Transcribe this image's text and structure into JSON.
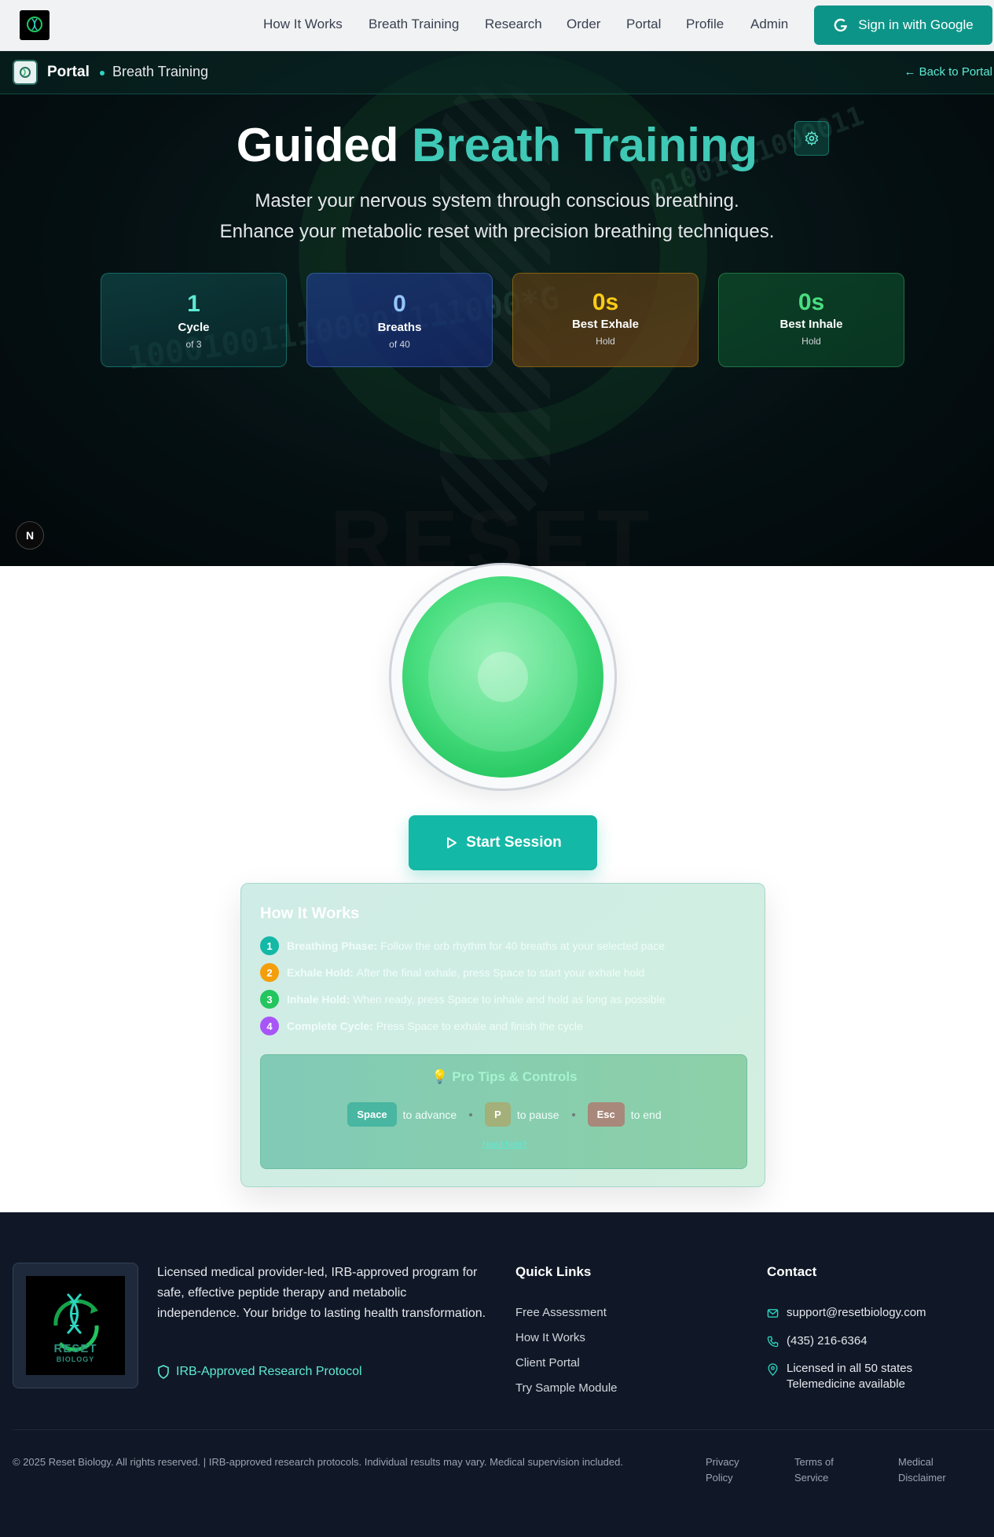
{
  "nav": {
    "links": [
      "How It Works",
      "Breath Training",
      "Research",
      "Order",
      "Portal",
      "Profile",
      "Admin"
    ],
    "sign_in": "Sign in with Google"
  },
  "breadcrumb": {
    "portal": "Portal",
    "page": "Breath Training",
    "back": "← Back to Portal"
  },
  "hero": {
    "title_1": "Guided",
    "title_2": "Breath Training",
    "subtitle_1": "Master your nervous system through conscious breathing.",
    "subtitle_2": "Enhance your metabolic reset with precision breathing techniques.",
    "bg_binary_1": "01001011000011",
    "bg_binary_2": "100010011100001111000*G",
    "bg_reset": "RESET",
    "next_badge": "N"
  },
  "stats": [
    {
      "value": "1",
      "label": "Cycle",
      "sub": "of 3",
      "color": "#5eead4"
    },
    {
      "value": "0",
      "label": "Breaths",
      "sub": "of 40",
      "color": "#93c5fd"
    },
    {
      "value": "0s",
      "label": "Best Exhale",
      "sub": "Hold",
      "color": "#facc15"
    },
    {
      "value": "0s",
      "label": "Best Inhale",
      "sub": "Hold",
      "color": "#4ade80"
    }
  ],
  "session": {
    "start": "Start Session"
  },
  "how": {
    "title": "How It Works",
    "steps": [
      {
        "n": "1",
        "b": "Breathing Phase:",
        "t": "Follow the orb rhythm for 40 breaths at your selected pace",
        "color": "#14b8a6"
      },
      {
        "n": "2",
        "b": "Exhale Hold:",
        "t": "After the final exhale, press Space to start your exhale hold",
        "color": "#f59e0b"
      },
      {
        "n": "3",
        "b": "Inhale Hold:",
        "t": "When ready, press Space to inhale and hold as long as possible",
        "color": "#22c55e"
      },
      {
        "n": "4",
        "b": "Complete Cycle:",
        "t": "Press Space to exhale and finish the cycle",
        "color": "#a855f7"
      }
    ],
    "tips_title": "💡 Pro Tips & Controls",
    "keys": [
      {
        "key": "Space",
        "desc": "to advance",
        "color": "#48b6a0"
      },
      {
        "key": "P",
        "desc": "to pause",
        "color": "#a3b07a"
      },
      {
        "key": "Esc",
        "desc": "to end",
        "color": "#a8887a"
      }
    ],
    "need_help": "Need help?"
  },
  "footer": {
    "logo_text_1": "RESET",
    "logo_text_2": "BIOLOGY",
    "description": "Licensed medical provider-led, IRB-approved program for safe, effective peptide therapy and metabolic independence. Your bridge to lasting health transformation.",
    "irb": "IRB-Approved Research Protocol",
    "quick_links_title": "Quick Links",
    "quick_links": [
      "Free Assessment",
      "How It Works",
      "Client Portal",
      "Try Sample Module"
    ],
    "contact_title": "Contact",
    "email": "support@resetbiology.com",
    "phone": "(435) 216-6364",
    "license_1": "Licensed in all 50 states",
    "license_2": "Telemedicine available",
    "copyright": "© 2025 Reset Biology. All rights reserved. | IRB-approved research protocols. Individual results may vary. Medical supervision included.",
    "legal": [
      "Privacy Policy",
      "Terms of Service",
      "Medical Disclaimer"
    ]
  }
}
